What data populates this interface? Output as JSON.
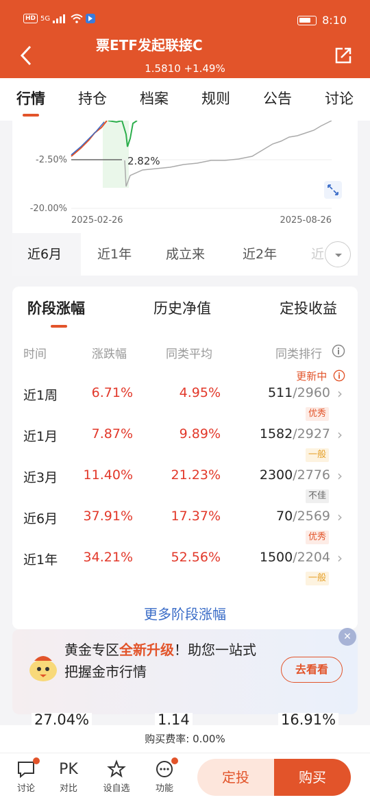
{
  "status_bar": {
    "network": "HD",
    "signal": "5G",
    "time": "8:10"
  },
  "header": {
    "title": "票ETF发起联接C",
    "subtitle": "1.5810 +1.49%"
  },
  "tabs": [
    "行情",
    "持仓",
    "档案",
    "规则",
    "公告",
    "讨论"
  ],
  "chart": {
    "y_label_top": "-2.50%",
    "y_label_bottom": "-20.00%",
    "x_start": "2025-02-26",
    "x_end": "2025-08-26",
    "marker_label": "2.82%"
  },
  "ranges": [
    "近6月",
    "近1年",
    "成立来",
    "近2年",
    "近"
  ],
  "performance": {
    "tabs": [
      "阶段涨幅",
      "历史净值",
      "定投收益"
    ],
    "columns": {
      "time": "时间",
      "change": "涨跌幅",
      "avg": "同类平均",
      "rank": "同类排行"
    },
    "updating": "更新中",
    "rows": [
      {
        "period": "近1周",
        "change": "6.71%",
        "avg": "4.95%",
        "rank": "511",
        "total": "/2960",
        "badge": "优秀",
        "badge_type": "good"
      },
      {
        "period": "近1月",
        "change": "7.87%",
        "avg": "9.89%",
        "rank": "1582",
        "total": "/2927",
        "badge": "一般",
        "badge_type": "avg"
      },
      {
        "period": "近3月",
        "change": "11.40%",
        "avg": "21.23%",
        "rank": "2300",
        "total": "/2776",
        "badge": "不佳",
        "badge_type": "bad"
      },
      {
        "period": "近6月",
        "change": "37.91%",
        "avg": "17.37%",
        "rank": "70",
        "total": "/2569",
        "badge": "优秀",
        "badge_type": "good"
      },
      {
        "period": "近1年",
        "change": "34.21%",
        "avg": "52.56%",
        "rank": "1500",
        "total": "/2204",
        "badge": "一般",
        "badge_type": "avg"
      }
    ],
    "more": "更多阶段涨幅"
  },
  "banner": {
    "line1_a": "黄金专区",
    "line1_hl": "全新升级",
    "line1_b": "！助您一站式",
    "line2": "把握金市行情",
    "button": "去看看",
    "close": "✕"
  },
  "partial_values": [
    "27.04%",
    "1.14",
    "16.91%"
  ],
  "fee": "购买费率: 0.00%",
  "bottom": {
    "items": [
      {
        "label": "讨论",
        "icon": "chat-icon"
      },
      {
        "label": "对比",
        "icon": "pk-icon",
        "icon_text": "PK"
      },
      {
        "label": "设自选",
        "icon": "star-icon"
      },
      {
        "label": "功能",
        "icon": "more-icon"
      }
    ],
    "dingtou": "定投",
    "buy": "购买"
  },
  "colors": {
    "accent": "#e2542a",
    "up": "#e2382a",
    "link": "#3a6cc7"
  }
}
